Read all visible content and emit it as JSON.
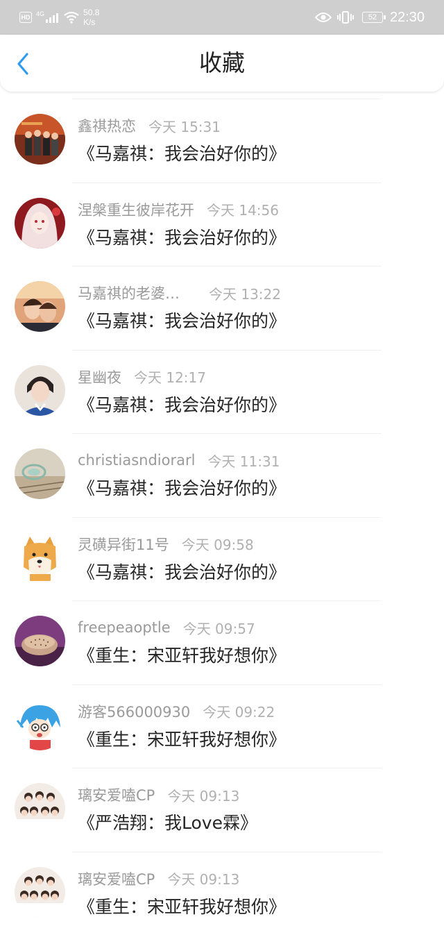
{
  "status_bar": {
    "hd": "HD",
    "network": "4G",
    "speed_value": "50.8",
    "speed_unit": "K/s",
    "battery": "52",
    "time": "22:30"
  },
  "header": {
    "title": "收藏"
  },
  "favorites": [
    {
      "username": "鑫祺热恋",
      "time": "今天 15:31",
      "title": "《马嘉祺：我会治好你的》"
    },
    {
      "username": "涅槃重生彼岸花开",
      "time": "今天 14:56",
      "title": "《马嘉祺：我会治好你的》"
    },
    {
      "username": "马嘉祺的老婆…",
      "time": "今天 13:22",
      "title": "《马嘉祺：我会治好你的》"
    },
    {
      "username": "星幽夜",
      "time": "今天 12:17",
      "title": "《马嘉祺：我会治好你的》"
    },
    {
      "username": "christiasndiorarl",
      "time": "今天 11:31",
      "title": "《马嘉祺：我会治好你的》"
    },
    {
      "username": "灵磺异街11号",
      "time": "今天 09:58",
      "title": "《马嘉祺：我会治好你的》"
    },
    {
      "username": "freepeaoptle",
      "time": "今天 09:57",
      "title": "《重生：宋亚轩我好想你》"
    },
    {
      "username": "游客566000930",
      "time": "今天 09:22",
      "title": "《重生：宋亚轩我好想你》"
    },
    {
      "username": "璃安爱嗑CP",
      "time": "今天 09:13",
      "title": "《严浩翔：我Love霖》"
    },
    {
      "username": "璃安爱嗑CP",
      "time": "今天 09:13",
      "title": "《重生：宋亚轩我好想你》"
    }
  ],
  "colors": {
    "accent": "#2e9bf0",
    "status_bar": "#cfcfcf"
  }
}
